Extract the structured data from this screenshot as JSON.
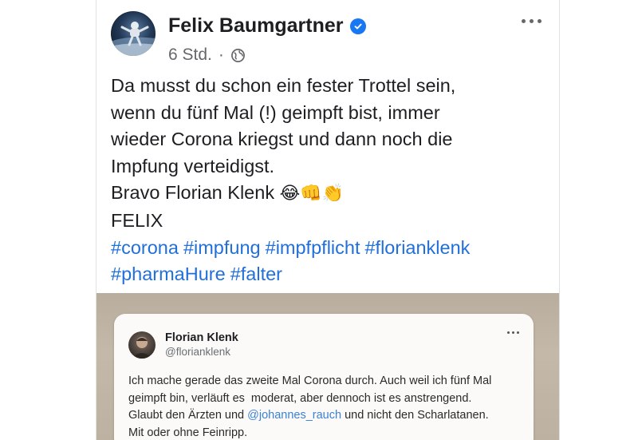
{
  "post": {
    "author": "Felix Baumgartner",
    "time": "6 Std.",
    "separator": "·",
    "text_lines": [
      "Da musst du schon ein fester Trottel sein,",
      "wenn du fünf Mal (!) geimpft bist, immer",
      "wieder Corona kriegst und dann noch die",
      "Impfung verteidigst."
    ],
    "bravo_text": "Bravo Florian Klenk",
    "emojis": [
      "😂",
      "👊",
      "👏"
    ],
    "signature": "FELIX",
    "hashtags": [
      "#corona",
      "#impfung",
      "#impfpflicht",
      "#florianklenk",
      "#pharmaHure",
      "#falter"
    ]
  },
  "embedded_tweet": {
    "name": "Florian Klenk",
    "handle": "@florianklenk",
    "line1": "Ich mache gerade das zweite Mal Corona durch. Auch weil ich fünf Mal",
    "line2": "geimpft bin, verläuft es  moderat, aber dennoch ist es anstrengend.",
    "line3_pre": "Glaubt den Ärzten und ",
    "line3_mention": "@johannes_rauch",
    "line3_post": " und nicht den Scharlatanen.",
    "line4": "Mit oder ohne Feinripp."
  },
  "colors": {
    "link": "#216fdb",
    "verified": "#1877f2",
    "text": "#1c1e21",
    "muted": "#65676b"
  }
}
